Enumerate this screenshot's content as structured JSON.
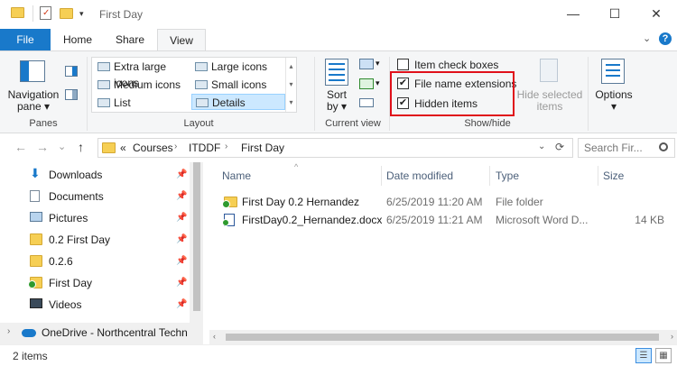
{
  "window": {
    "title": "First Day"
  },
  "titlebar": {
    "minimize": "—",
    "maximize": "☐",
    "close": "✕"
  },
  "tabs": [
    "File",
    "Home",
    "Share",
    "View"
  ],
  "ribbon_right": {
    "collapse": "⌄",
    "help": "?"
  },
  "ribbon": {
    "panes": {
      "nav_label_1": "Navigation",
      "nav_label_2": "pane",
      "group": "Panes"
    },
    "layout": {
      "items": [
        "Extra large icons",
        "Large icons",
        "Medium icons",
        "Small icons",
        "List",
        "Details"
      ],
      "group": "Layout"
    },
    "current_view": {
      "sort_1": "Sort",
      "sort_2": "by",
      "group": "Current view"
    },
    "show_hide": {
      "item_check_boxes": "Item check boxes",
      "file_name_extensions": "File name extensions",
      "hidden_items": "Hidden items",
      "hide_selected_1": "Hide selected",
      "hide_selected_2": "items",
      "group": "Show/hide",
      "checkmark": "✔"
    },
    "options": {
      "label": "Options"
    }
  },
  "address": {
    "back": "←",
    "forward": "→",
    "up_arrow": "⌄",
    "up": "↑",
    "prefix": "«",
    "crumbs": [
      "Courses",
      "ITDDF",
      "First Day"
    ],
    "refresh": "⟳",
    "search_placeholder": "Search Fir..."
  },
  "navpane": {
    "items": [
      "Downloads",
      "Documents",
      "Pictures",
      "0.2 First Day",
      "0.2.6",
      "First Day",
      "Videos",
      "OneDrive - Northcentral Techn"
    ]
  },
  "content": {
    "columns": [
      "Name",
      "Date modified",
      "Type",
      "Size"
    ],
    "rows": [
      {
        "name": "First Day 0.2 Hernandez",
        "date": "6/25/2019 11:20 AM",
        "type": "File folder",
        "size": ""
      },
      {
        "name": "FirstDay0.2_Hernandez.docx",
        "date": "6/25/2019 11:21 AM",
        "type": "Microsoft Word D...",
        "size": "14 KB"
      }
    ]
  },
  "status": {
    "items": "2 items"
  }
}
